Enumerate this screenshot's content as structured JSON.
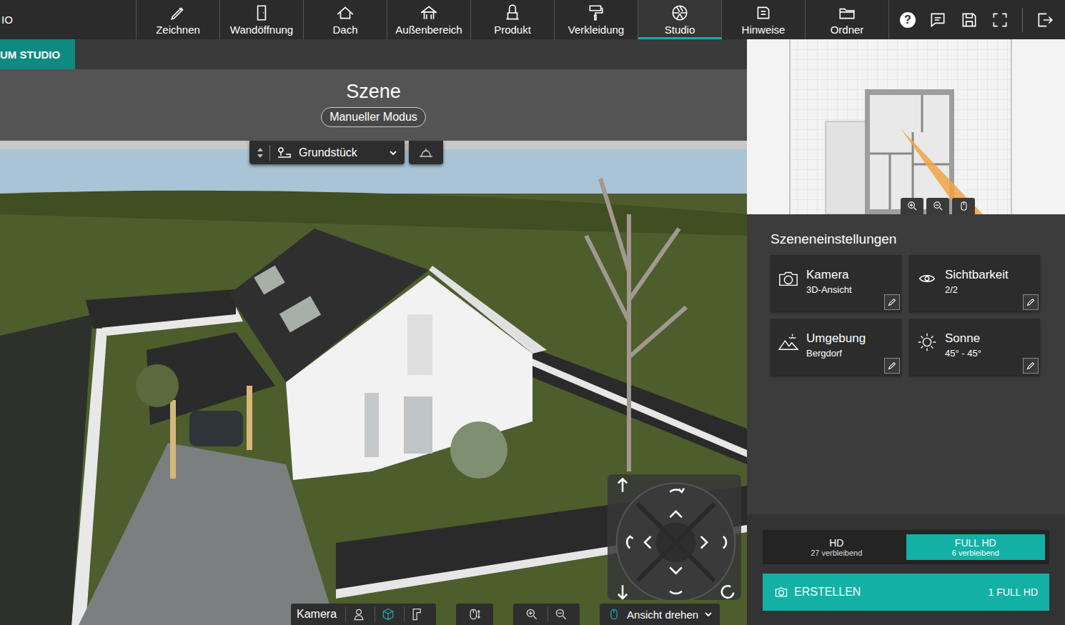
{
  "app": {
    "title_fragment": "IO"
  },
  "tabs": [
    {
      "kind": "draw",
      "label": "Zeichnen",
      "selected": false
    },
    {
      "kind": "opening",
      "label": "Wandöffnung",
      "selected": false
    },
    {
      "kind": "roof",
      "label": "Dach",
      "selected": false
    },
    {
      "kind": "outdoor",
      "label": "Außenbereich",
      "selected": false
    },
    {
      "kind": "product",
      "label": "Produkt",
      "selected": false
    },
    {
      "kind": "cladding",
      "label": "Verkleidung",
      "selected": false
    },
    {
      "kind": "studio",
      "label": "Studio",
      "selected": true
    },
    {
      "kind": "notes",
      "label": "Hinweise",
      "selected": false
    },
    {
      "kind": "folder",
      "label": "Ordner",
      "selected": false
    }
  ],
  "help_glyph": "?",
  "breadcrumb": "UM STUDIO",
  "header": {
    "title": "Szene",
    "mode": "Manueller Modus"
  },
  "view_selector": {
    "value": "Grundstück"
  },
  "bottom_toolbar": {
    "camera_label": "Kamera",
    "views": [
      {
        "kind": "person",
        "selected": false
      },
      {
        "kind": "cube",
        "selected": true
      },
      {
        "kind": "plan",
        "selected": false
      }
    ],
    "mode": "Ansicht drehen"
  },
  "settings": {
    "title": "Szeneneinstellungen",
    "cards": [
      {
        "kind": "camera",
        "title": "Kamera",
        "value": "3D-Ansicht"
      },
      {
        "kind": "visibility",
        "title": "Sichtbarkeit",
        "value": "2/2"
      },
      {
        "kind": "environment",
        "title": "Umgebung",
        "value": "Bergdorf"
      },
      {
        "kind": "sun",
        "title": "Sonne",
        "value": "45° - 45°"
      }
    ]
  },
  "quality": [
    {
      "label": "HD",
      "remaining": "27 verbleibend",
      "selected": false
    },
    {
      "label": "FULL HD",
      "remaining": "6 verbleibend",
      "selected": true
    }
  ],
  "create_button": {
    "label": "ERSTELLEN",
    "cost": "1 FULL HD"
  }
}
